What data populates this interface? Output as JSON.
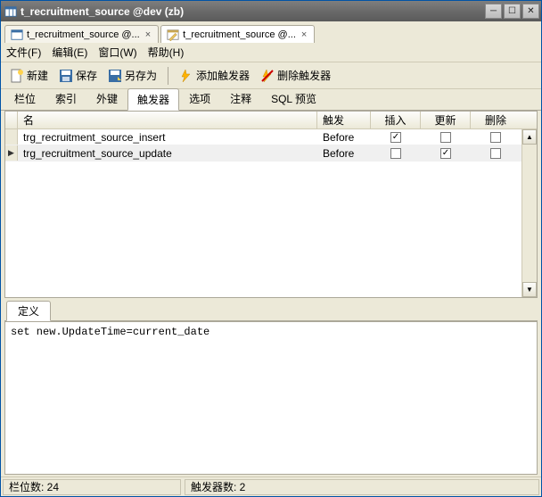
{
  "window": {
    "title": "t_recruitment_source @dev (zb)"
  },
  "doc_tabs": [
    {
      "label": "t_recruitment_source @...",
      "active": false
    },
    {
      "label": "t_recruitment_source @...",
      "active": true
    }
  ],
  "menu": {
    "file": "文件(F)",
    "edit": "编辑(E)",
    "window": "窗口(W)",
    "help": "帮助(H)"
  },
  "toolbar": {
    "new": "新建",
    "save": "保存",
    "saveas": "另存为",
    "add_trigger": "添加触发器",
    "del_trigger": "删除触发器"
  },
  "subtabs": {
    "cols": "栏位",
    "index": "索引",
    "fk": "外键",
    "trigger": "触发器",
    "options": "选项",
    "comment": "注释",
    "sqlpreview": "SQL 预览"
  },
  "grid": {
    "headers": {
      "name": "名",
      "fire": "触发",
      "insert": "插入",
      "update": "更新",
      "delete": "删除"
    },
    "rows": [
      {
        "name": "trg_recruitment_source_insert",
        "fire": "Before",
        "insert": true,
        "update": false,
        "delete": false,
        "current": false
      },
      {
        "name": "trg_recruitment_source_update",
        "fire": "Before",
        "insert": false,
        "update": true,
        "delete": false,
        "current": true
      }
    ]
  },
  "definition": {
    "tab": "定义",
    "text": "set new.UpdateTime=current_date"
  },
  "status": {
    "cols": "栏位数: 24",
    "triggers": "触发器数: 2"
  }
}
